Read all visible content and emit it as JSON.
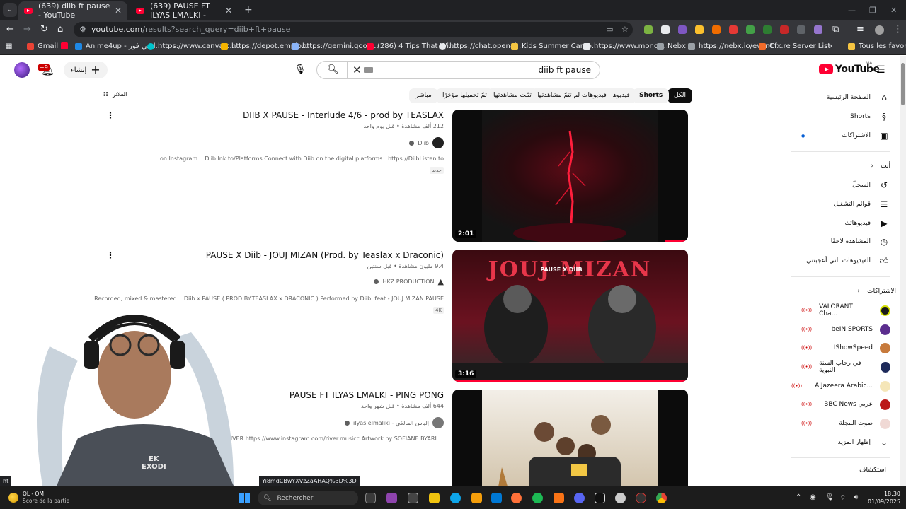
{
  "tabs": [
    {
      "title": "(639) diib ft pause - YouTube",
      "close": "✕"
    },
    {
      "title": "(639) PAUSE FT ILYAS LMALKI - ",
      "close": "✕"
    }
  ],
  "new_tab": "+",
  "address": {
    "host": "youtube.com",
    "path": "/results?search_query=diib+ft+pause"
  },
  "bookmarks": [
    {
      "label": "Gmail",
      "color": "#ea4335"
    },
    {
      "label": "Anime4up - انمي فور...",
      "color": "#1e88e5"
    },
    {
      "label": "https://www.canva.c...",
      "color": "#00c4cc"
    },
    {
      "label": "https://depot.emplo...",
      "color": "#f5b400"
    },
    {
      "label": "https://gemini.goog...",
      "color": "#8ab4f8"
    },
    {
      "label": "(286) 4 Tips That Wi...",
      "color": "#ff0033"
    },
    {
      "label": "https://chat.openai....",
      "color": "#e8eaed"
    },
    {
      "label": "Kids Summer Camp...",
      "color": "#f5c542"
    },
    {
      "label": "https://www.moncv...",
      "color": "#e8eaed"
    },
    {
      "label": "Nebx",
      "color": "#9aa0a6"
    },
    {
      "label": "https://nebx.io/event",
      "color": "#9aa0a6"
    },
    {
      "label": "Cfx.re Server List",
      "color": "#f26b2a"
    }
  ],
  "bookmarks_more": "»",
  "all_bookmarks": "Tous les favoris",
  "header": {
    "notifications": "+9",
    "create": "إنشاء",
    "search_query": "diib ft pause",
    "logo": "YouTube",
    "logo_region": "MA"
  },
  "filters_label": "الفلاتر",
  "chips": [
    "الكل",
    "Shorts",
    "فيديوهات",
    "فيديوهات لم تتمّ مشاهدتها",
    "تمّت مشاهدتها",
    "تمّ تحميلها مؤخرًا",
    "مباشر"
  ],
  "results": [
    {
      "title": "DIIB X PAUSE - Interlude 4/6 - prod by TEASLAX",
      "meta": "212 ألف مشاهدة • قبل يوم واحد",
      "channel": "Diib",
      "snippet": "on Instagram ...Diib.lnk.to/Platforms Connect with Diib on the digital platforms : https://DiibListen to",
      "badge": "جديد",
      "duration": "2:01",
      "progress": 0.1
    },
    {
      "title": "PAUSE X Diib - JOUJ MIZAN (Prod. by Teaslax x Draconic)",
      "meta": "9.4 مليون مشاهدة • قبل سنتين",
      "channel": "HKZ PRODUCTION",
      "snippet": "Recorded, mixed & mastered ...Diib x PAUSE ( PROD BY.TEASLAX x DRACONIC ) Performed by Diib. feat - JOUJ MIZAN PAUSE",
      "badge": "4K",
      "duration": "3:16",
      "progress": 1.0,
      "thumb_text": "JOUJ MIZAN",
      "thumb_sub": "PAUSE X DIIB"
    },
    {
      "title": "PAUSE FT ILYAS LMALKI - PING PONG",
      "meta": "644 ألف مشاهدة • قبل شهر واحد",
      "channel": "ilyas elmaliki - إلياس المالكي",
      "snippet": "ering ; RIVER https://www.instagram.com/river.musicc Artwork by SOFIANE BYARI ..."
    }
  ],
  "sidebar": {
    "main": [
      "الصفحة الرئيسية",
      "Shorts",
      "الاشتراكات"
    ],
    "you_head": "أنت",
    "you": [
      "السجلّ",
      "قوائم التشغيل",
      "فيديوهاتك",
      "المشاهدة لاحقًا",
      "الفيديوهات التي أعجبتني"
    ],
    "subs_head": "الاشتراكات",
    "subs": [
      {
        "name": "VALORANT Cha...",
        "color": "#1a1a1a"
      },
      {
        "name": "beIN SPORTS",
        "color": "#5b2d8e"
      },
      {
        "name": "IShowSpeed",
        "color": "#c77a3c"
      },
      {
        "name": "في رحاب السنة النبوية",
        "color": "#1e2a5a"
      },
      {
        "name": "AlJazeera Arabic...",
        "color": "#d9a400"
      },
      {
        "name": "BBC News عربي",
        "color": "#bb1919"
      },
      {
        "name": "صوت المجلة",
        "color": "#c0392b"
      }
    ],
    "show_more": "إظهار المزيد",
    "explore_head": "استكشاف"
  },
  "status_url": "Yi8mdCBwYXVzZaAHAQ%3D%3D",
  "status_left": "ht",
  "taskbar": {
    "weather_title": "OL - OM",
    "weather_sub": "Score de la partie",
    "search": "Rechercher",
    "time": "18:30",
    "date": "01/09/2025"
  },
  "webcam_text": "EXODI",
  "webcam_text2": "EK"
}
